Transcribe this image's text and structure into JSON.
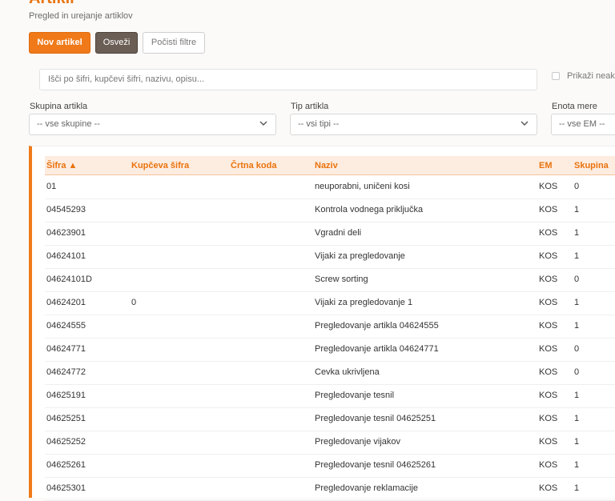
{
  "header": {
    "title": "Artikli",
    "subtitle": "Pregled in urejanje artiklov"
  },
  "toolbar": {
    "new_label": "Nov artikel",
    "refresh_label": "Osveži",
    "clear_label": "Počisti filtre"
  },
  "search": {
    "placeholder": "Išči po šifri, kupčevi šifri, nazivu, opisu...",
    "checkbox_label": "Prikaži neak",
    "checkbox_checked": false
  },
  "filters": [
    {
      "label": "Skupina artikla",
      "value": "-- vse skupine --"
    },
    {
      "label": "Tip artikla",
      "value": "-- vsi tipi --"
    },
    {
      "label": "Enota mere",
      "value": "-- vse EM --"
    }
  ],
  "colors": {
    "accent": "#f07a1a",
    "header_bg": "#fdece0",
    "dark_button": "#6b5e55"
  },
  "table": {
    "sorted_column": "sifra",
    "sort_direction": "ascending",
    "columns": {
      "sifra": "Šifra ▲",
      "kupceva": "Kupčeva šifra",
      "crtna": "Črtna koda",
      "naziv": "Naziv",
      "em": "EM",
      "skupina": "Skupina"
    },
    "rows": [
      {
        "sifra": "01",
        "kupceva": "",
        "crtna": "",
        "naziv": "neuporabni, uničeni kosi",
        "em": "KOS",
        "skupina": "0"
      },
      {
        "sifra": "04545293",
        "kupceva": "",
        "crtna": "",
        "naziv": "Kontrola vodnega priključka",
        "em": "KOS",
        "skupina": "1"
      },
      {
        "sifra": "04623901",
        "kupceva": "",
        "crtna": "",
        "naziv": "Vgradni deli",
        "em": "KOS",
        "skupina": "1"
      },
      {
        "sifra": "04624101",
        "kupceva": "",
        "crtna": "",
        "naziv": "Vijaki za pregledovanje",
        "em": "KOS",
        "skupina": "1"
      },
      {
        "sifra": "04624101D",
        "kupceva": "",
        "crtna": "",
        "naziv": "Screw sorting",
        "em": "KOS",
        "skupina": "0"
      },
      {
        "sifra": "04624201",
        "kupceva": "0",
        "crtna": "",
        "naziv": "Vijaki za pregledovanje 1",
        "em": "KOS",
        "skupina": "1"
      },
      {
        "sifra": "04624555",
        "kupceva": "",
        "crtna": "",
        "naziv": "Pregledovanje artikla 04624555",
        "em": "KOS",
        "skupina": "1"
      },
      {
        "sifra": "04624771",
        "kupceva": "",
        "crtna": "",
        "naziv": "Pregledovanje artikla 04624771",
        "em": "KOS",
        "skupina": "0"
      },
      {
        "sifra": "04624772",
        "kupceva": "",
        "crtna": "",
        "naziv": "Cevka ukrivljena",
        "em": "KOS",
        "skupina": "0"
      },
      {
        "sifra": "04625191",
        "kupceva": "",
        "crtna": "",
        "naziv": "Pregledovanje tesnil",
        "em": "KOS",
        "skupina": "1"
      },
      {
        "sifra": "04625251",
        "kupceva": "",
        "crtna": "",
        "naziv": "Pregledovanje tesnil 04625251",
        "em": "KOS",
        "skupina": "1"
      },
      {
        "sifra": "04625252",
        "kupceva": "",
        "crtna": "",
        "naziv": "Pregledovanje vijakov",
        "em": "KOS",
        "skupina": "1"
      },
      {
        "sifra": "04625261",
        "kupceva": "",
        "crtna": "",
        "naziv": "Pregledovanje tesnil 04625261",
        "em": "KOS",
        "skupina": "1"
      },
      {
        "sifra": "04625301",
        "kupceva": "",
        "crtna": "",
        "naziv": "Pregledovanje reklamacije",
        "em": "KOS",
        "skupina": "1"
      }
    ]
  }
}
